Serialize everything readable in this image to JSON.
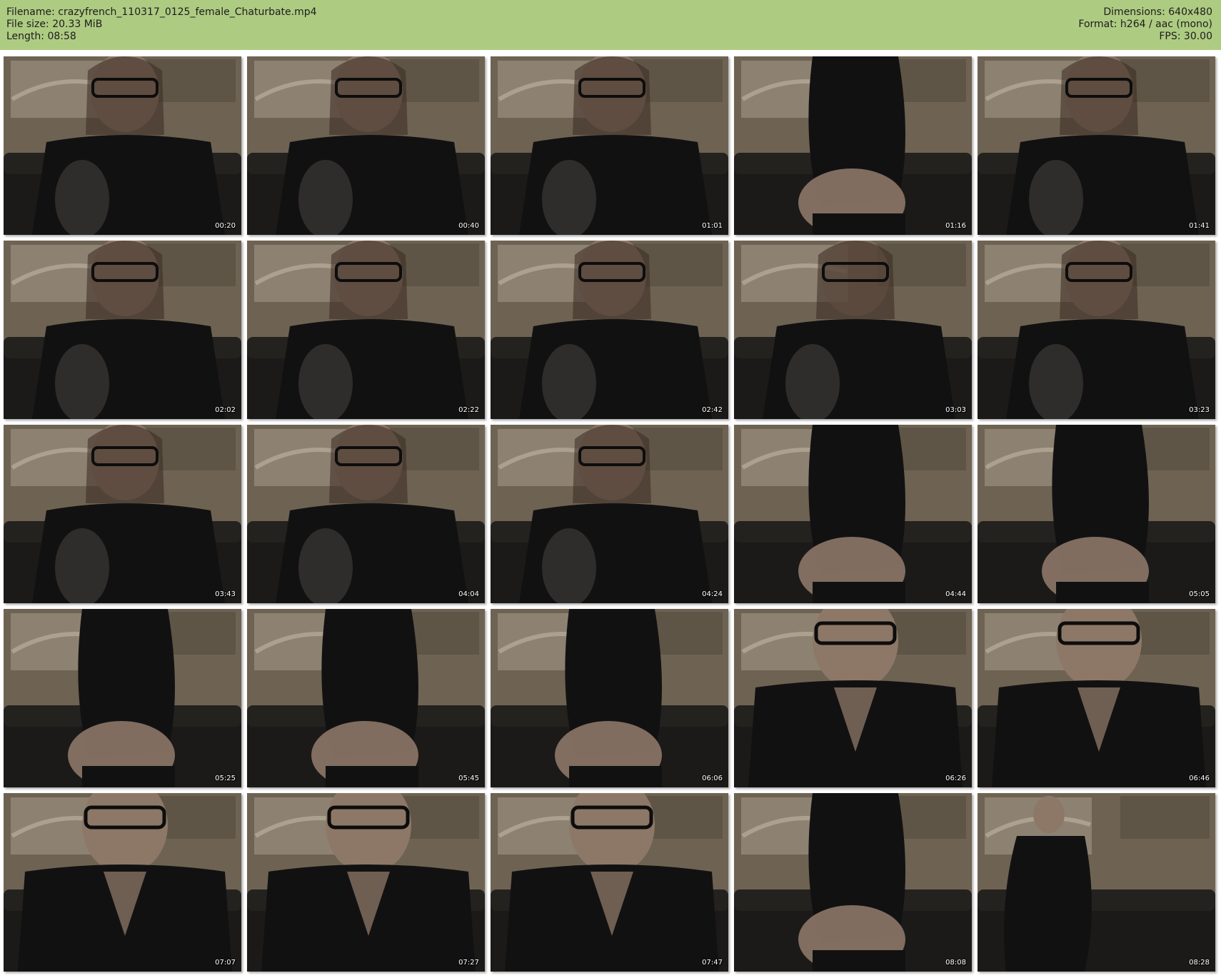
{
  "header": {
    "left": [
      "Filename: crazyfrench_110317_0125_female_Chaturbate.mp4",
      "File size: 20.33 MiB",
      "Length: 08:58"
    ],
    "right": [
      "Dimensions: 640x480",
      "Format: h264 / aac (mono)",
      "FPS: 30.00"
    ]
  },
  "thumbnails": [
    {
      "time": "00:20",
      "scene": "seated-face"
    },
    {
      "time": "00:40",
      "scene": "seated-face"
    },
    {
      "time": "01:01",
      "scene": "seated-face"
    },
    {
      "time": "01:16",
      "scene": "standing-turned"
    },
    {
      "time": "01:41",
      "scene": "seated-face"
    },
    {
      "time": "02:02",
      "scene": "seated-face"
    },
    {
      "time": "02:22",
      "scene": "seated-face"
    },
    {
      "time": "02:42",
      "scene": "seated-face"
    },
    {
      "time": "03:03",
      "scene": "seated-blur"
    },
    {
      "time": "03:23",
      "scene": "seated-face"
    },
    {
      "time": "03:43",
      "scene": "seated-face"
    },
    {
      "time": "04:04",
      "scene": "seated-face"
    },
    {
      "time": "04:24",
      "scene": "seated-face"
    },
    {
      "time": "04:44",
      "scene": "standing-turned"
    },
    {
      "time": "05:05",
      "scene": "standing-turned"
    },
    {
      "time": "05:25",
      "scene": "standing-turned"
    },
    {
      "time": "05:45",
      "scene": "standing-turned"
    },
    {
      "time": "06:06",
      "scene": "standing-turned"
    },
    {
      "time": "06:26",
      "scene": "close-face"
    },
    {
      "time": "06:46",
      "scene": "close-face"
    },
    {
      "time": "07:07",
      "scene": "close-face"
    },
    {
      "time": "07:27",
      "scene": "close-face"
    },
    {
      "time": "07:47",
      "scene": "close-face"
    },
    {
      "time": "08:08",
      "scene": "standing-turned"
    },
    {
      "time": "08:28",
      "scene": "standing-far"
    }
  ],
  "colors": {
    "header_bg": "#aecb82",
    "wall": "#6e6352",
    "couch": "#1b1a18",
    "clothing": "#121112",
    "skin": "#8d7868"
  }
}
